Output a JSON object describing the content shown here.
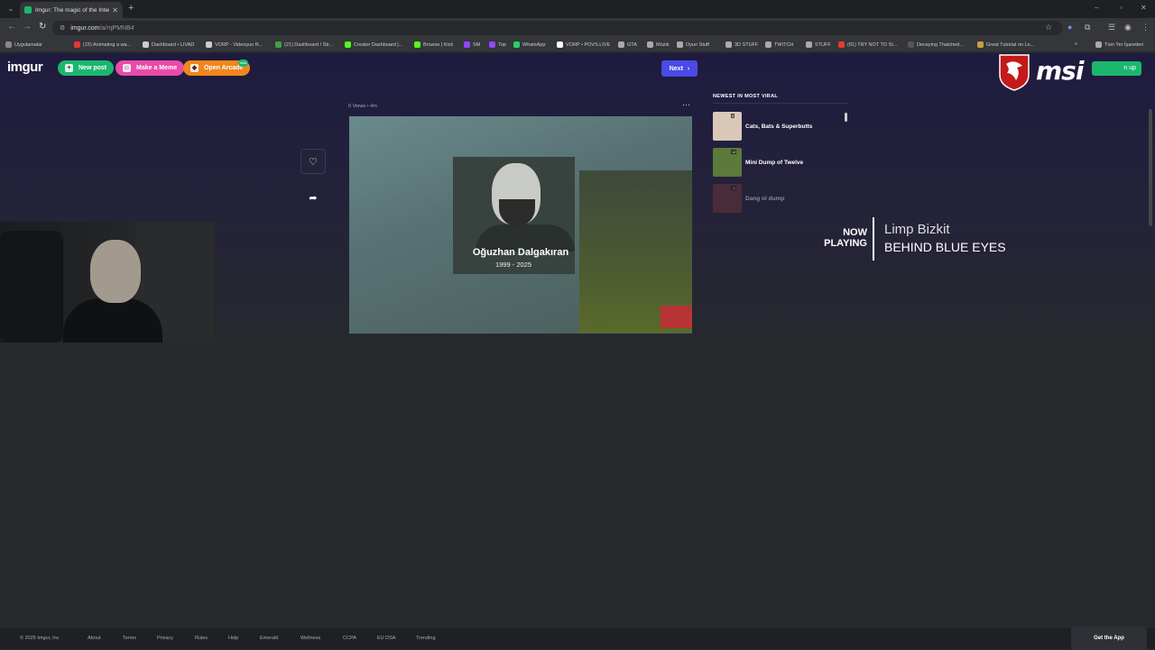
{
  "browser": {
    "tab_title": "Imgur: The magic of the Interne",
    "url_host": "imgur.com",
    "url_path": "/a/rqPMNB4",
    "bookmarks": [
      {
        "label": "Uygulamalar",
        "color": "#888888"
      },
      {
        "label": "(15) Animating a wa...",
        "color": "#e53935"
      },
      {
        "label": "Dashboard • LIVAD",
        "color": "#cccccc"
      },
      {
        "label": "VORP - Videoyun R...",
        "color": "#cccccc"
      },
      {
        "label": "(21) Dashboard / Str...",
        "color": "#43a047"
      },
      {
        "label": "Creator Dashboard |...",
        "color": "#53fc18"
      },
      {
        "label": "Browse | Kick",
        "color": "#53fc18"
      },
      {
        "label": "SM",
        "color": "#9146ff"
      },
      {
        "label": "Top",
        "color": "#9146ff"
      },
      {
        "label": "WhatsApp",
        "color": "#25d366"
      },
      {
        "label": "VORP • POVS.LIVE",
        "color": "#ffffff"
      },
      {
        "label": "GTA",
        "color": "#aaaaaa"
      },
      {
        "label": "Müzik",
        "color": "#aaaaaa"
      },
      {
        "label": "Oyun Stuff",
        "color": "#aaaaaa"
      },
      {
        "label": "3D STUFF",
        "color": "#aaaaaa"
      },
      {
        "label": "TWITCH",
        "color": "#aaaaaa"
      },
      {
        "label": "STUFF",
        "color": "#aaaaaa"
      },
      {
        "label": "(81) TRY NOT TO SI...",
        "color": "#e53935"
      },
      {
        "label": "Decaying Thatched...",
        "color": "#555555"
      },
      {
        "label": "Great Tutorial on Lo...",
        "color": "#c8a040"
      }
    ],
    "all_bookmarks": "Tüm Yer İşaretleri"
  },
  "header": {
    "logo": "imgur",
    "new_post": "New post",
    "make_meme": "Make a Meme",
    "open_arcade": "Open Arcade",
    "arcade_badge": "beta",
    "next": "Next",
    "signup": "n up",
    "ad_brand": "msi"
  },
  "post": {
    "meta": "0 Views • 4m",
    "image_name": "Oğuzhan Dalgakıran",
    "image_years": "1999 - 2025"
  },
  "viral": {
    "heading": "NEWEST IN MOST VIRAL",
    "items": [
      {
        "title": "Cats, Bats & Superbutts",
        "count": "3",
        "color": "#d9c8b8"
      },
      {
        "title": "Mini Dump of Twelve",
        "count": "12",
        "color": "#5c7a3a"
      },
      {
        "title": "Dang ol dump",
        "count": "10",
        "color": "#7a3a3a"
      }
    ]
  },
  "now_playing": {
    "label_line1": "NOW",
    "label_line2": "PLAYING",
    "artist": "Limp Bizkit",
    "song": "BEHIND BLUE EYES"
  },
  "footer": {
    "copyright": "© 2025 Imgur, Inc",
    "links": [
      "About",
      "Terms",
      "Privacy",
      "Rules",
      "Help",
      "Emerald",
      "Wellness",
      "CCPA",
      "EU DSA",
      "Trending"
    ],
    "get_app": "Get the App"
  },
  "colors": {
    "new_post": "#1bb76e",
    "make_meme": "#e94ba8",
    "open_arcade": "#f0861e",
    "next": "#4a4ae6",
    "msi_red": "#c41a1a"
  }
}
